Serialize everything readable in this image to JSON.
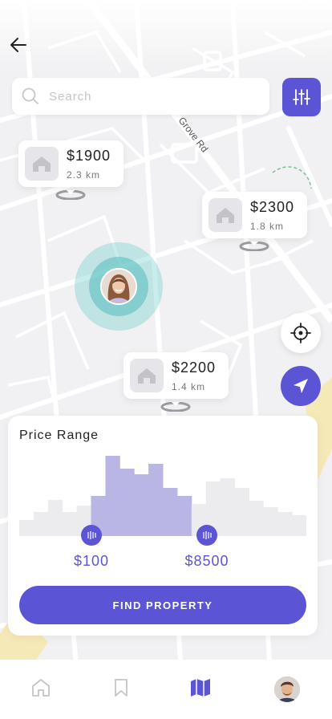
{
  "search": {
    "placeholder": "Search"
  },
  "map": {
    "street_label": "Grove Rd"
  },
  "pins": [
    {
      "price": "$1900",
      "distance": "2.3 km"
    },
    {
      "price": "$2300",
      "distance": "1.8 km"
    },
    {
      "price": "$2200",
      "distance": "1.4 km"
    }
  ],
  "price_range": {
    "title": "Price Range",
    "min_label": "$100",
    "max_label": "$8500",
    "histogram": [
      0.2,
      0.3,
      0.45,
      0.3,
      0.38,
      0.5,
      1.0,
      0.84,
      0.77,
      0.9,
      0.6,
      0.5,
      0.4,
      0.68,
      0.72,
      0.6,
      0.44,
      0.36,
      0.3,
      0.26
    ],
    "selected_from_bin": 5,
    "selected_to_bin": 12,
    "accent_color": "#5b55d6",
    "selected_color": "#b9b6e6",
    "unselected_color": "#ececee"
  },
  "actions": {
    "find_label": "FIND PROPERTY"
  },
  "tabbar": {
    "items": [
      {
        "icon": "home-icon",
        "active": false
      },
      {
        "icon": "bookmark-icon",
        "active": false
      },
      {
        "icon": "map-icon",
        "active": true
      },
      {
        "icon": "profile-avatar",
        "active": false
      }
    ]
  }
}
